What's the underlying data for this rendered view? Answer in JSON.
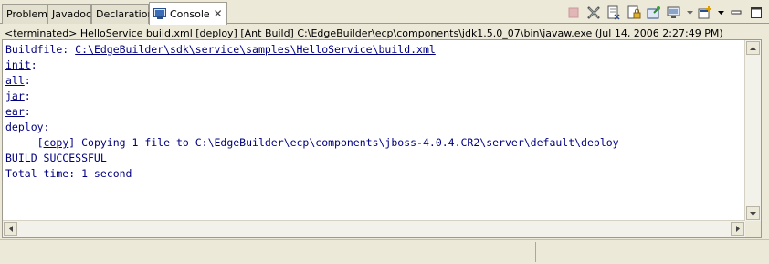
{
  "tabs": [
    {
      "label": "Problems",
      "active": false
    },
    {
      "label": "Javadoc",
      "active": false
    },
    {
      "label": "Declaration",
      "active": false
    },
    {
      "label": "Console",
      "active": true,
      "icon": "console-icon",
      "close": "✕"
    }
  ],
  "toolbar": {
    "items": [
      "terminate-icon",
      "remove-launch-icon",
      "clear-console-icon",
      "scroll-lock-icon",
      "pin-console-icon",
      "display-selected-console-icon",
      "open-console-icon"
    ]
  },
  "description": "<terminated> HelloService build.xml [deploy] [Ant Build] C:\\EdgeBuilder\\ecp\\components\\jdk1.5.0_07\\bin\\javaw.exe (Jul 14, 2006 2:27:49 PM)",
  "console": {
    "buildfile_prefix": "Buildfile: ",
    "buildfile_path": "C:\\EdgeBuilder\\sdk\\service\\samples\\HelloService\\build.xml",
    "targets": [
      "init",
      "all",
      "jar",
      "ear",
      "deploy"
    ],
    "target_suffix": ":",
    "copy_indent": "     [",
    "copy_task": "copy",
    "copy_message": "] Copying 1 file to C:\\EdgeBuilder\\ecp\\components\\jboss-4.0.4.CR2\\server\\default\\deploy",
    "result": "BUILD SUCCESSFUL",
    "total_time": "Total time: 1 second"
  },
  "colors": {
    "console_text": "#00007f",
    "background": "#ece9d8"
  }
}
